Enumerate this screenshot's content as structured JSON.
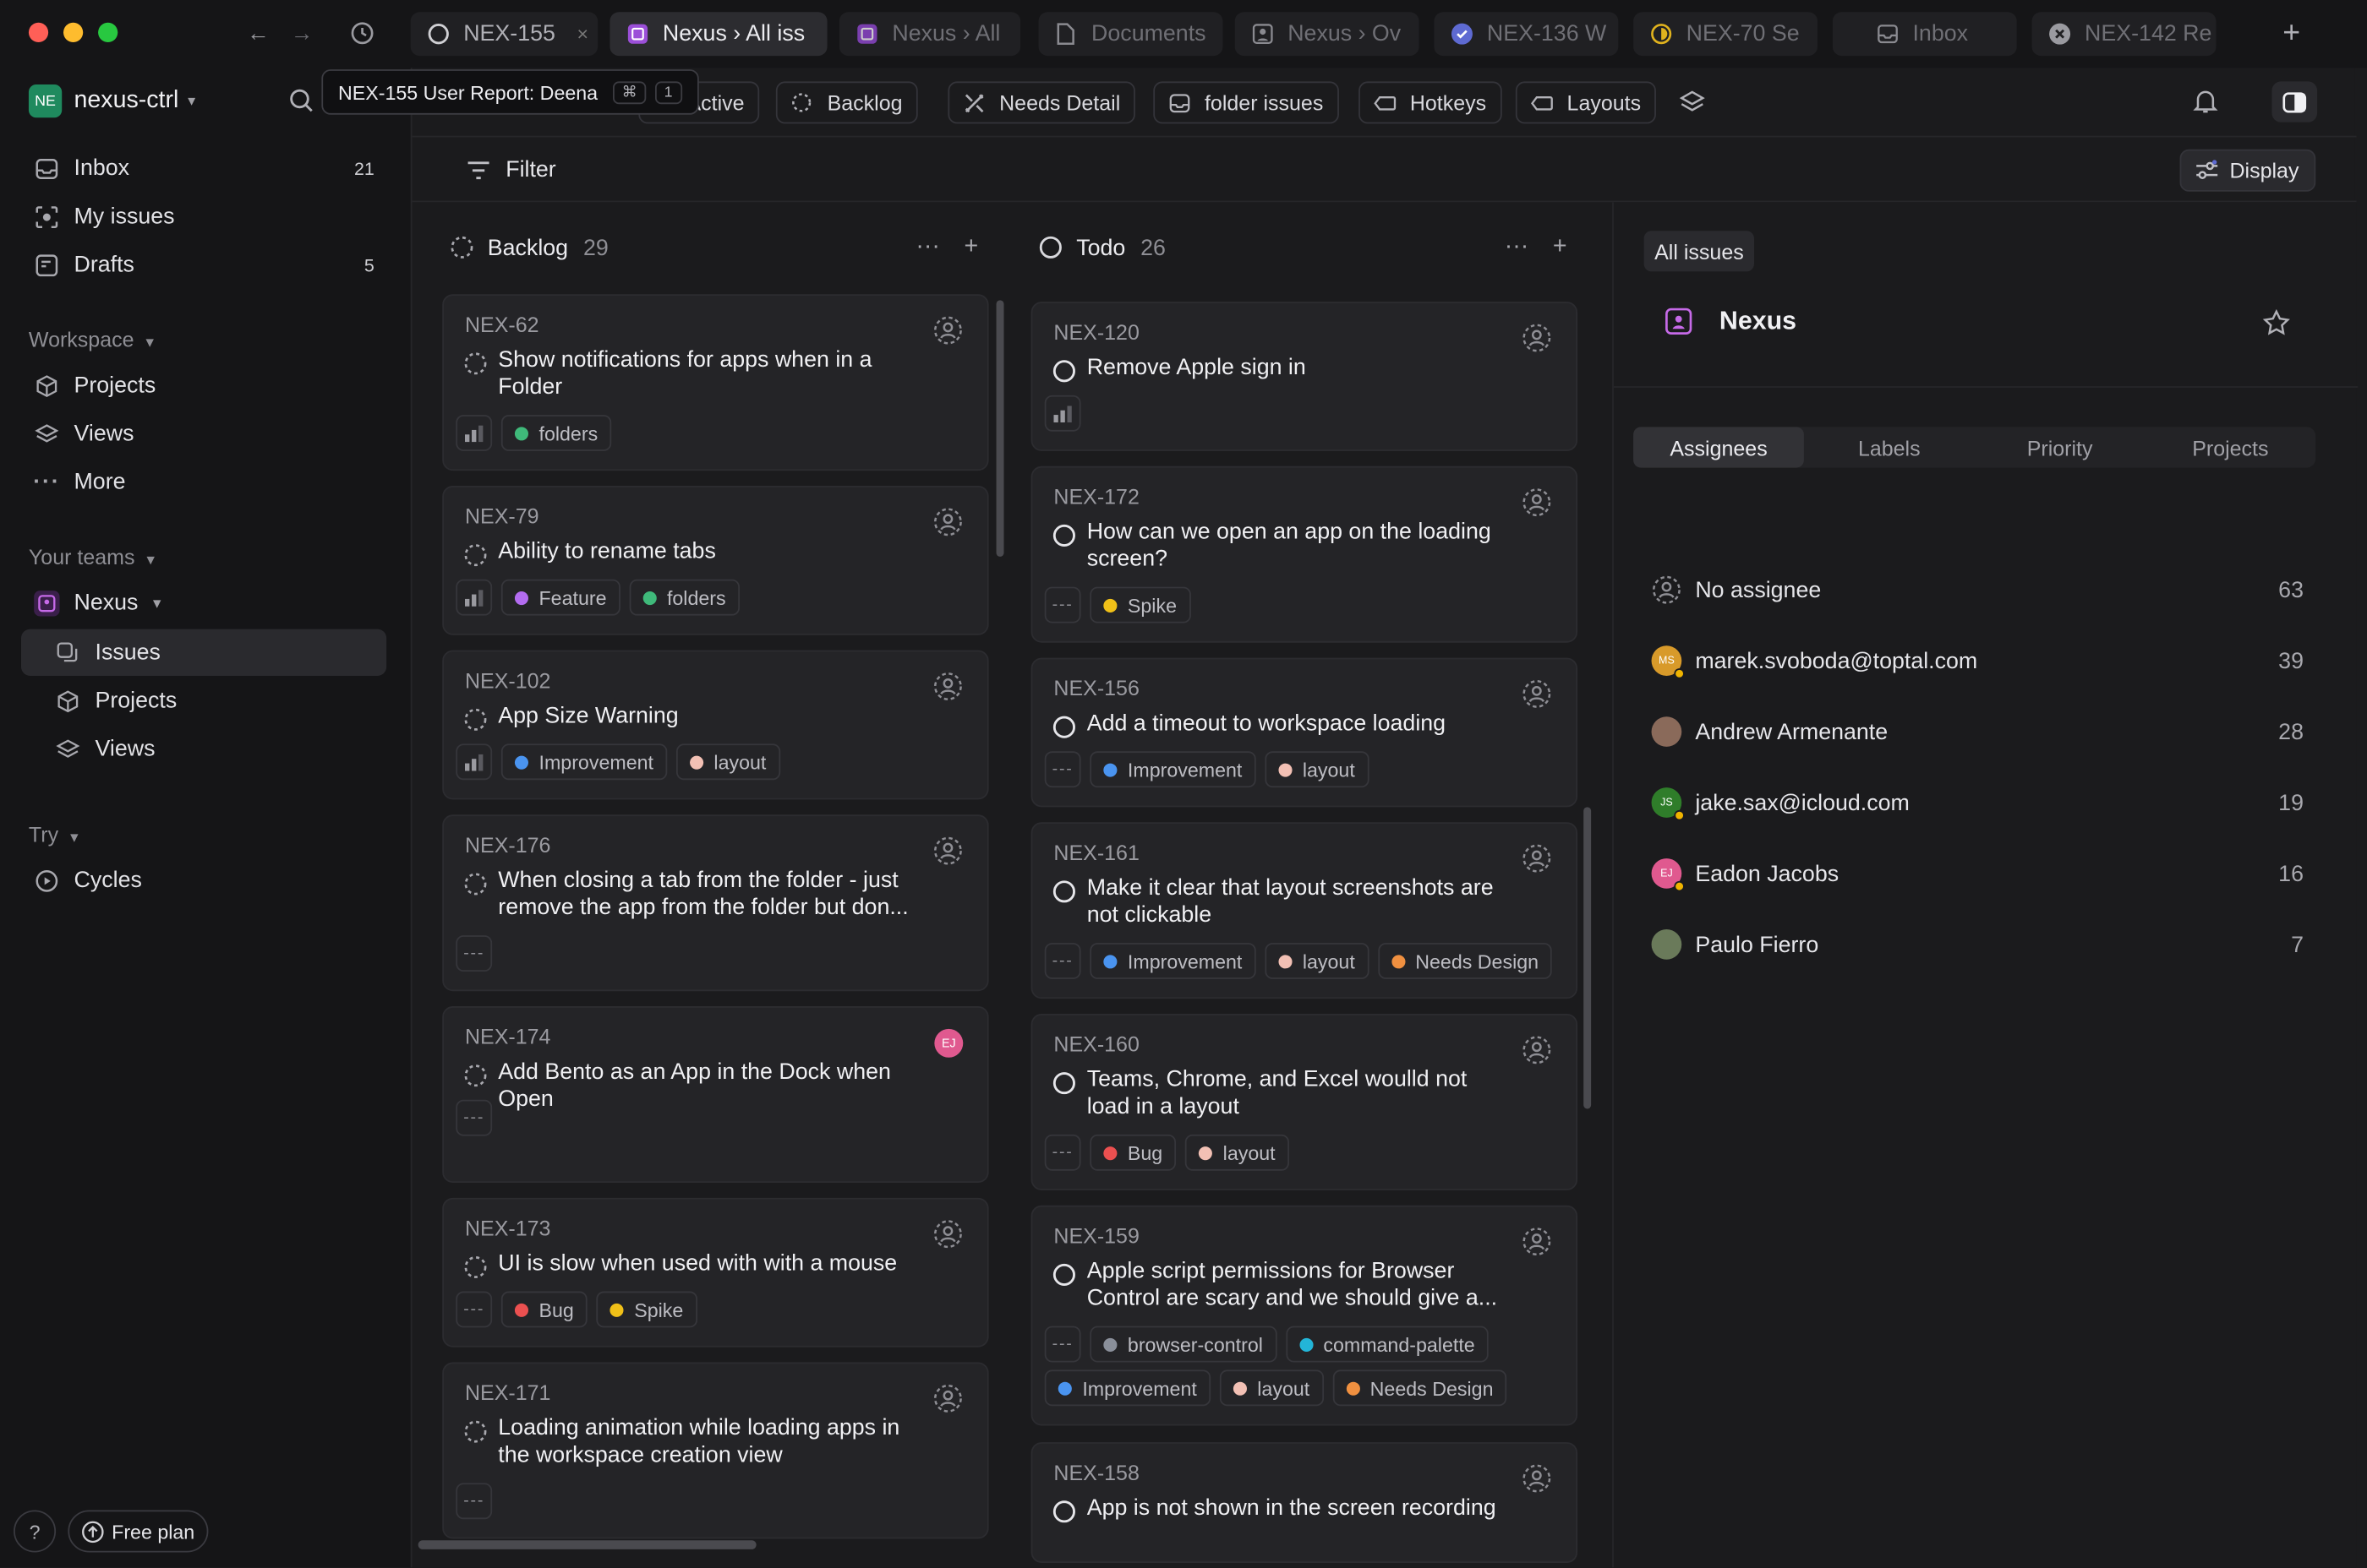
{
  "titlebar": {
    "tabs": [
      {
        "label": "NEX-155",
        "icon": "circle-icon",
        "active": false,
        "close": "×"
      },
      {
        "label": "Nexus › All iss",
        "icon": "purple-doc-icon",
        "active": true
      },
      {
        "label": "Nexus › All",
        "icon": "purple-doc-icon",
        "active": false
      },
      {
        "label": "Documents",
        "icon": "document-icon",
        "active": false
      },
      {
        "label": "Nexus › Ov",
        "icon": "person-square-icon",
        "active": false
      },
      {
        "label": "NEX-136 W",
        "icon": "check-circle-icon",
        "active": false
      },
      {
        "label": "NEX-70 Se",
        "icon": "half-circle-icon",
        "active": false
      },
      {
        "label": "Inbox",
        "icon": "inbox-icon",
        "active": false
      },
      {
        "label": "NEX-142 Re",
        "icon": "x-circle-icon",
        "active": false
      }
    ],
    "new_tab": "+"
  },
  "tooltip": {
    "text": "NEX-155 User Report: Deena",
    "kbd1": "⌘",
    "kbd2": "1"
  },
  "workspace": {
    "avatar": "NE",
    "name": "nexus-ctrl"
  },
  "sidebar": {
    "top": [
      {
        "label": "Inbox",
        "count": "21"
      },
      {
        "label": "My issues",
        "count": ""
      },
      {
        "label": "Drafts",
        "count": "5"
      }
    ],
    "workspace_title": "Workspace",
    "workspace_items": [
      {
        "label": "Projects"
      },
      {
        "label": "Views"
      },
      {
        "label": "More"
      }
    ],
    "teams_title": "Your teams",
    "team": {
      "label": "Nexus"
    },
    "team_items": [
      {
        "label": "Issues"
      },
      {
        "label": "Projects"
      },
      {
        "label": "Views"
      }
    ],
    "try_title": "Try",
    "try_items": [
      {
        "label": "Cycles"
      }
    ],
    "help": "?",
    "plan": "Free plan"
  },
  "viewbar": {
    "pills": [
      {
        "label": "Active"
      },
      {
        "label": "Backlog"
      },
      {
        "label": "Needs Detail"
      },
      {
        "label": "folder issues"
      },
      {
        "label": "Hotkeys"
      },
      {
        "label": "Layouts"
      }
    ]
  },
  "filter": {
    "label": "Filter",
    "display": "Display"
  },
  "columns": [
    {
      "name": "Backlog",
      "count": "29",
      "cards": [
        {
          "id": "NEX-62",
          "title": "Show notifications for apps when in a Folder",
          "priority": "bars",
          "labels": [
            {
              "name": "folders",
              "color": "#3fb97a"
            }
          ]
        },
        {
          "id": "NEX-79",
          "title": "Ability to rename tabs",
          "priority": "bars",
          "labels": [
            {
              "name": "Feature",
              "color": "#b36cf0"
            },
            {
              "name": "folders",
              "color": "#3fb97a"
            }
          ]
        },
        {
          "id": "NEX-102",
          "title": "App Size Warning",
          "priority": "bars",
          "labels": [
            {
              "name": "Improvement",
              "color": "#4a94f0"
            },
            {
              "name": "layout",
              "color": "#f2c0b4"
            }
          ]
        },
        {
          "id": "NEX-176",
          "title": "When closing a tab from the folder - just remove the app from the folder but don...",
          "priority": "---",
          "labels": []
        },
        {
          "id": "NEX-174",
          "title": "Add Bento as an App in the Dock when Open",
          "priority": "---",
          "labels": [],
          "avatar": "EJ"
        },
        {
          "id": "NEX-173",
          "title": "UI is slow when used with with a mouse",
          "priority": "---",
          "labels": [
            {
              "name": "Bug",
              "color": "#eb5050"
            },
            {
              "name": "Spike",
              "color": "#f0c018"
            }
          ]
        },
        {
          "id": "NEX-171",
          "title": "Loading animation while loading apps in the workspace creation view",
          "priority": "---",
          "labels": []
        }
      ]
    },
    {
      "name": "Todo",
      "count": "26",
      "cards": [
        {
          "id": "NEX-120",
          "title": "Remove Apple sign in",
          "priority": "bars",
          "labels": []
        },
        {
          "id": "NEX-172",
          "title": "How can we open an app on the loading screen?",
          "priority": "---",
          "labels": [
            {
              "name": "Spike",
              "color": "#f0c018"
            }
          ]
        },
        {
          "id": "NEX-156",
          "title": "Add a timeout to workspace loading",
          "priority": "---",
          "labels": [
            {
              "name": "Improvement",
              "color": "#4a94f0"
            },
            {
              "name": "layout",
              "color": "#f2c0b4"
            }
          ]
        },
        {
          "id": "NEX-161",
          "title": "Make it clear that layout screenshots are not clickable",
          "priority": "---",
          "labels": [
            {
              "name": "Improvement",
              "color": "#4a94f0"
            },
            {
              "name": "layout",
              "color": "#f2c0b4"
            },
            {
              "name": "Needs Design",
              "color": "#f09040"
            }
          ]
        },
        {
          "id": "NEX-160",
          "title": "Teams, Chrome, and Excel woulld not load in a layout",
          "priority": "---",
          "labels": [
            {
              "name": "Bug",
              "color": "#eb5050"
            },
            {
              "name": "layout",
              "color": "#f2c0b4"
            }
          ]
        },
        {
          "id": "NEX-159",
          "title": "Apple script permissions for Browser Control are scary and we should give a...",
          "priority": "---",
          "labels": [
            {
              "name": "browser-control",
              "color": "#8a8f9a"
            },
            {
              "name": "command-palette",
              "color": "#23b5d8"
            }
          ],
          "labels2": [
            {
              "name": "Improvement",
              "color": "#4a94f0"
            },
            {
              "name": "layout",
              "color": "#f2c0b4"
            },
            {
              "name": "Needs Design",
              "color": "#f09040"
            }
          ]
        },
        {
          "id": "NEX-158",
          "title": "App is not shown in the screen recording",
          "priority": "",
          "labels": []
        }
      ]
    }
  ],
  "panel": {
    "crumb": "All issues",
    "team": "Nexus",
    "tabs": [
      {
        "label": "Assignees"
      },
      {
        "label": "Labels"
      },
      {
        "label": "Priority"
      },
      {
        "label": "Projects"
      }
    ],
    "assignees": [
      {
        "name": "No assignee",
        "count": "63",
        "initials": "",
        "color": ""
      },
      {
        "name": "marek.svoboda@toptal.com",
        "count": "39",
        "initials": "MS",
        "color": "#d89a2a"
      },
      {
        "name": "Andrew Armenante",
        "count": "28",
        "initials": "",
        "color": "#8a6a5a"
      },
      {
        "name": "jake.sax@icloud.com",
        "count": "19",
        "initials": "JS",
        "color": "#2f7d2a"
      },
      {
        "name": "Eadon Jacobs",
        "count": "16",
        "initials": "EJ",
        "color": "#e0598f"
      },
      {
        "name": "Paulo Fierro",
        "count": "7",
        "initials": "",
        "color": "#6a7a5a"
      }
    ]
  }
}
